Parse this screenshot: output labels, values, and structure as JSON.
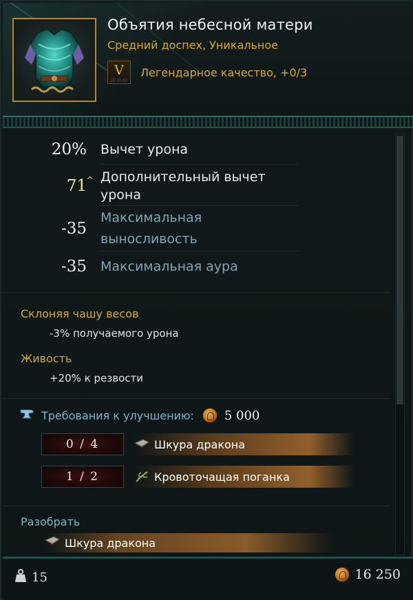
{
  "item": {
    "name": "Объятия небесной матери",
    "type": "Средний доспех, Уникальное",
    "quality_badge": "V",
    "quality_label": "Легендарное качество, +0/3"
  },
  "stats": [
    {
      "value": "20%",
      "label": "Вычет урона",
      "style": "normal"
    },
    {
      "value": "71",
      "label": "Дополнительный вычет урона",
      "style": "gold-upgraded"
    },
    {
      "value": "-35",
      "label": "Максимальная выносливость",
      "style": "blue"
    },
    {
      "value": "-35",
      "label": "Максимальная аура",
      "style": "blue"
    }
  ],
  "perks": [
    {
      "name": "Склоняя чашу весов",
      "desc": "-3% получаемого урона"
    },
    {
      "name": "Живость",
      "desc": "+20% к резвости"
    }
  ],
  "upgrade": {
    "title": "Требования к улучшению:",
    "cost": "5 000",
    "requirements": [
      {
        "count": "0 / 4",
        "item": "Шкура дракона",
        "icon": "hide-icon"
      },
      {
        "count": "1 / 2",
        "item": "Кровоточащая поганка",
        "icon": "herb-icon"
      }
    ]
  },
  "disassemble": {
    "title": "Разобрать",
    "item": "Шкура дракона",
    "icon": "hide-icon"
  },
  "footer": {
    "weight": "15",
    "price": "16 250"
  },
  "colors": {
    "gold": "#d4aa3b",
    "blue_label": "#7fa6b6",
    "accent_teal": "#24504c"
  }
}
